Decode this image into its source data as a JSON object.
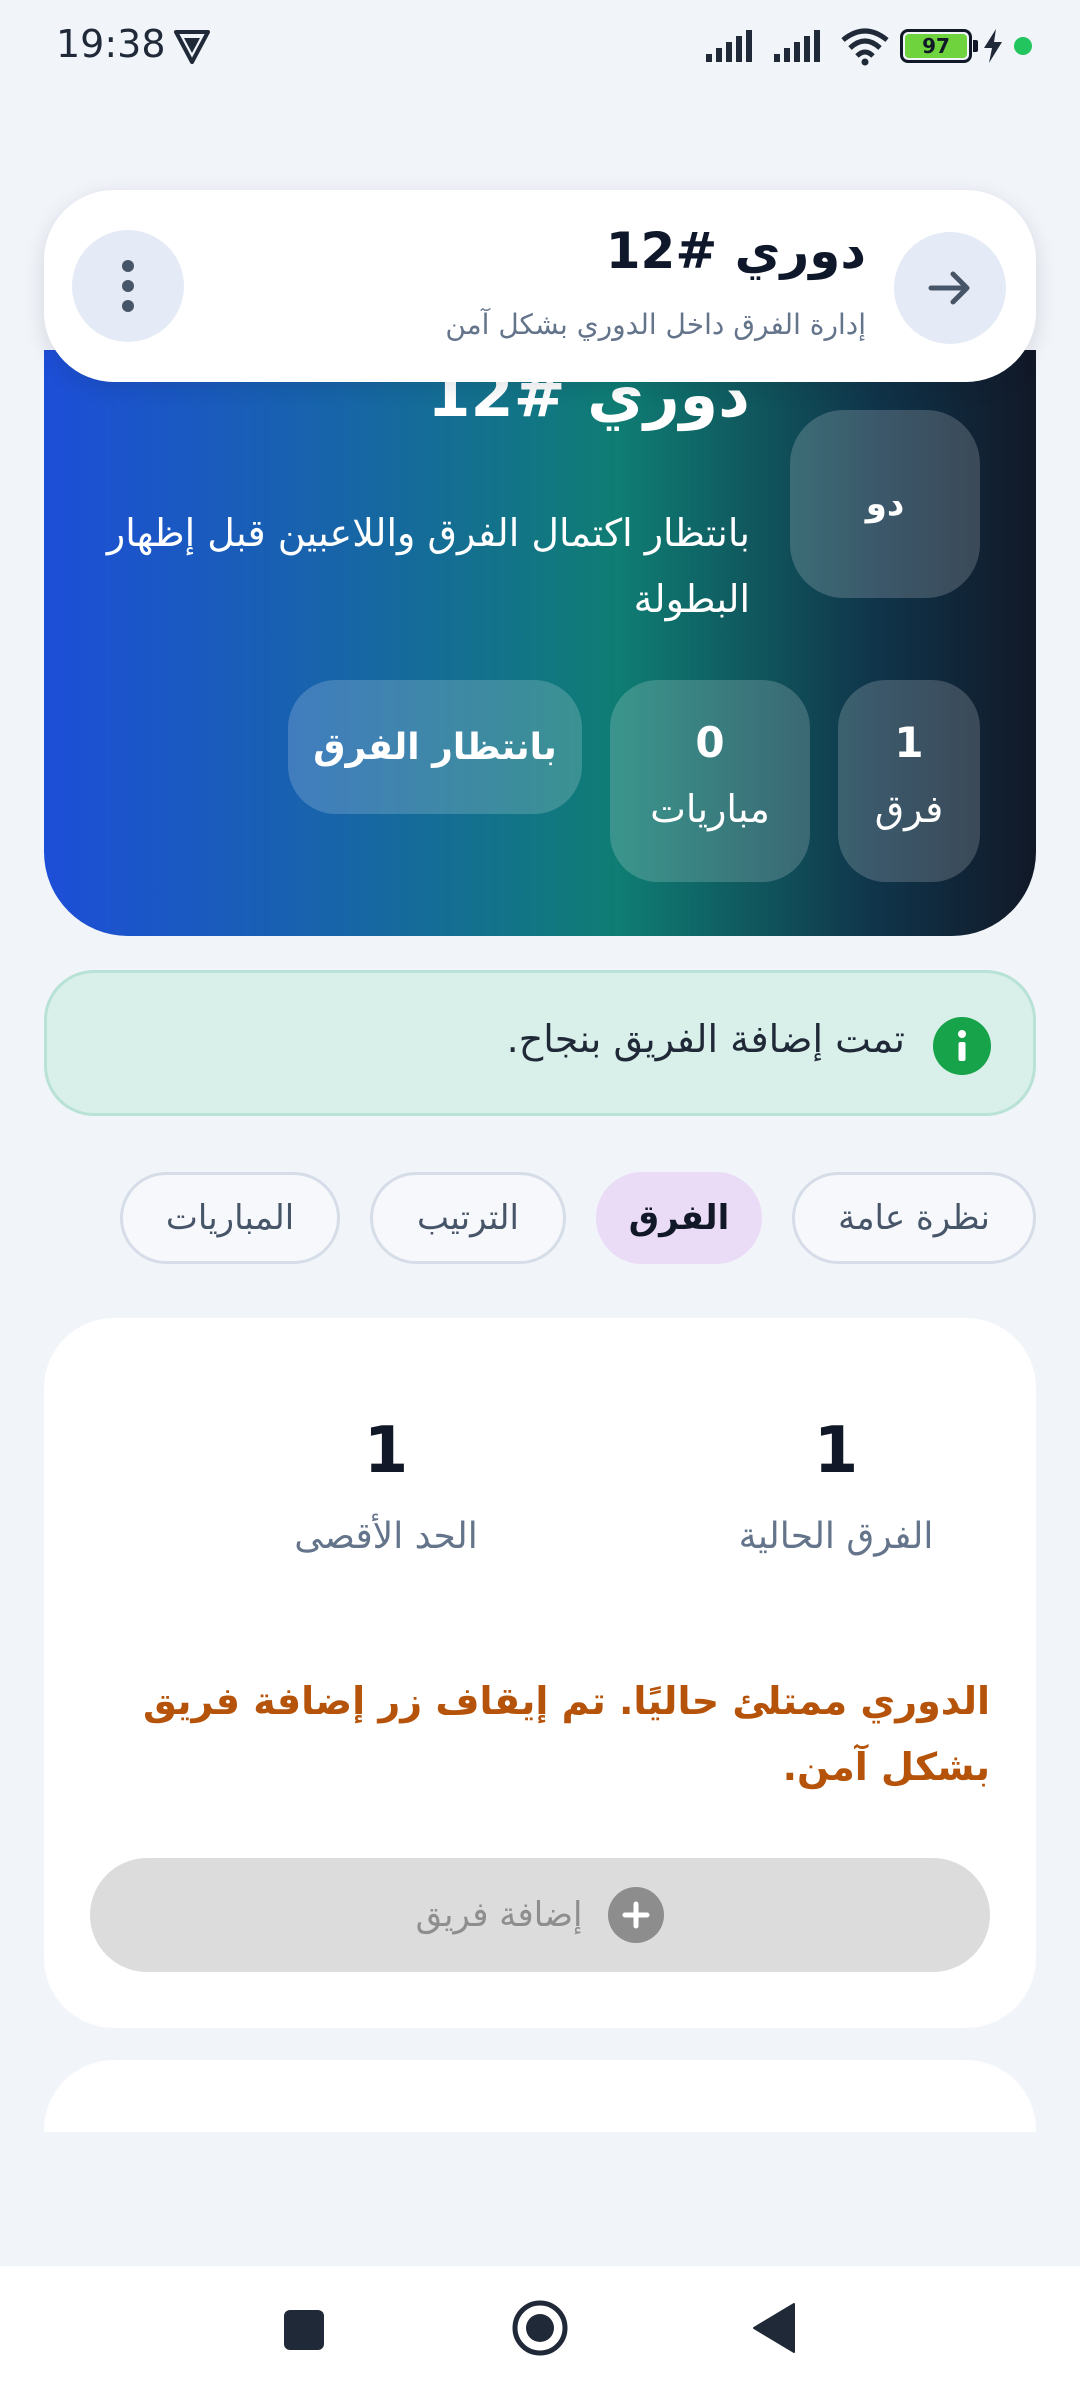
{
  "status_bar": {
    "time": "19:38",
    "battery_level": "97",
    "icons": [
      "vpn-shield-icon",
      "signal-icon",
      "signal-icon",
      "wifi-icon",
      "battery-icon",
      "charging-bolt-icon",
      "green-dot-icon"
    ]
  },
  "header": {
    "title": "دوري #12",
    "subtitle": "إدارة الفرق داخل الدوري بشكل آمن",
    "back_icon": "arrow-right-icon",
    "menu_icon": "more-vertical-icon"
  },
  "hero": {
    "title": "دوري #12",
    "avatar_text": "دو",
    "description": "بانتظار اكتمال الفرق واللاعبين قبل إظهار البطولة",
    "stats": {
      "teams": {
        "value": "1",
        "label": "فرق"
      },
      "matches": {
        "value": "0",
        "label": "مباريات"
      }
    },
    "status_label": "بانتظار الفرق"
  },
  "alert": {
    "message": "تمت إضافة الفريق بنجاح.",
    "icon": "info-icon"
  },
  "tabs": [
    {
      "label": "نظرة عامة",
      "active": false
    },
    {
      "label": "الفرق",
      "active": true
    },
    {
      "label": "الترتيب",
      "active": false
    },
    {
      "label": "المباريات",
      "active": false
    }
  ],
  "teams_panel": {
    "current": {
      "value": "1",
      "label": "الفرق الحالية"
    },
    "max": {
      "value": "1",
      "label": "الحد الأقصى"
    },
    "warning": "الدوري ممتلئ حاليًا. تم إيقاف زر إضافة فريق بشكل آمن.",
    "add_button_label": "إضافة فريق"
  },
  "colors": {
    "accent_tab": "#eadbf6",
    "alert_bg": "#d9efe9",
    "warning_text": "#b45309",
    "success_icon": "#16a34a"
  }
}
